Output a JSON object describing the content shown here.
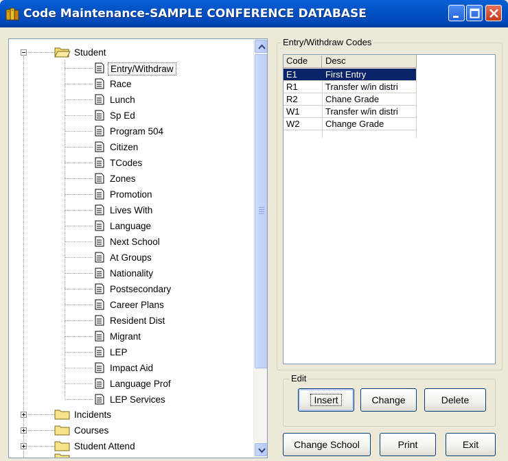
{
  "window": {
    "title": "Code Maintenance-SAMPLE CONFERENCE DATABASE",
    "controls": [
      "minimize",
      "maximize",
      "close"
    ]
  },
  "tree": {
    "root_nodes": [
      {
        "label": "Student",
        "expanded": true,
        "children": [
          "Entry/Withdraw",
          "Race",
          "Lunch",
          "Sp Ed",
          "Program 504",
          "Citizen",
          "TCodes",
          "Zones",
          "Promotion",
          "Lives With",
          "Language",
          "Next School",
          "At Groups",
          "Nationality",
          "Postsecondary",
          "Career Plans",
          "Resident Dist",
          "Migrant",
          "LEP",
          "Impact Aid",
          "Language Prof",
          "LEP Services"
        ],
        "selected_child": "Entry/Withdraw"
      },
      {
        "label": "Incidents",
        "expanded": false
      },
      {
        "label": "Courses",
        "expanded": false
      },
      {
        "label": "Student Attend",
        "expanded": false
      }
    ]
  },
  "codes_group": {
    "title": "Entry/Withdraw Codes",
    "columns": [
      "Code",
      "Desc"
    ],
    "rows": [
      {
        "code": "E1",
        "desc": "First Entry",
        "selected": true
      },
      {
        "code": "R1",
        "desc": "Transfer w/in distri",
        "selected": false
      },
      {
        "code": "R2",
        "desc": "Chane Grade",
        "selected": false
      },
      {
        "code": "W1",
        "desc": "Transfer w/in distri",
        "selected": false
      },
      {
        "code": "W2",
        "desc": "Change Grade",
        "selected": false
      }
    ]
  },
  "edit_group": {
    "title": "Edit",
    "buttons": {
      "insert": "Insert",
      "change": "Change",
      "delete": "Delete"
    }
  },
  "bottom_buttons": {
    "change_school": "Change School",
    "print": "Print",
    "exit": "Exit"
  },
  "colors": {
    "titlebar": "#0054e3",
    "selection": "#0a246a",
    "window_bg": "#ece9d8",
    "folder": "#f7e28c"
  },
  "icons": {
    "tree_folder_open": "folder-open-icon",
    "tree_folder": "folder-icon",
    "tree_leaf": "document-icon"
  }
}
